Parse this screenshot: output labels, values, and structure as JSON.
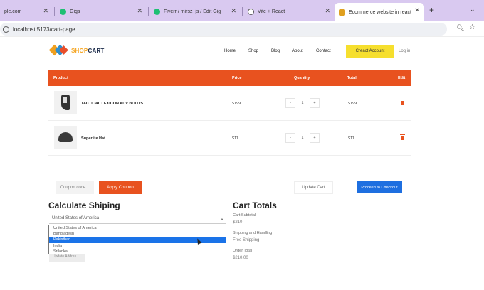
{
  "browser": {
    "tabs": [
      {
        "title": "ple.com",
        "color": "#1a73e8",
        "active": false
      },
      {
        "title": "Gigs",
        "color": "#1dbf73",
        "active": false
      },
      {
        "title": "Fiverr / mirsz_js / Edit Gig",
        "color": "#1dbf73",
        "active": false
      },
      {
        "title": "Vite + React",
        "color": "#555555",
        "active": false
      },
      {
        "title": "Ecommerce website in react",
        "color": "#e0a020",
        "active": true
      }
    ],
    "url": "localhost:5173/cart-page"
  },
  "header": {
    "logo_part1": "SHOP",
    "logo_part2": "CART",
    "nav": [
      "Home",
      "Shop",
      "Blog",
      "About",
      "Contact"
    ],
    "create_account": "Creact Account",
    "login": "Log in"
  },
  "table": {
    "headers": {
      "product": "Product",
      "price": "Price",
      "quantity": "Quantity",
      "total": "Total",
      "edit": "Edit"
    },
    "rows": [
      {
        "name": "TACTICAL LEXICON ADV BOOTS",
        "price": "$199",
        "qty": "1",
        "total": "$199",
        "minus": "-",
        "plus": "+"
      },
      {
        "name": "Superlite Hat",
        "price": "$11",
        "qty": "1",
        "total": "$11",
        "minus": "-",
        "plus": "+"
      }
    ]
  },
  "actions": {
    "coupon_placeholder": "Coupon code...",
    "apply_coupon": "Apply Coupon",
    "update_cart": "Update Cart",
    "checkout": "Proceed to Checkout"
  },
  "shipping": {
    "title": "Calculate Shiping",
    "selected": "United States of America",
    "options": [
      "United States of America",
      "Bangladesh",
      "Pakisthan",
      "India",
      "Srilanka"
    ],
    "highlighted_option": "Pakisthan",
    "button_label": "Update Addres"
  },
  "totals": {
    "title": "Cart Totals",
    "subtotal_label": "Cart Subtotal",
    "subtotal_value": "$210",
    "shipping_label": "Shipping and Handling",
    "shipping_value": "Free Shipping",
    "order_label": "Order Total",
    "order_value": "$210.00"
  },
  "colors": {
    "accent": "#e8521f",
    "primary_button": "#1e6fe0",
    "create_button": "#f6df2e"
  }
}
